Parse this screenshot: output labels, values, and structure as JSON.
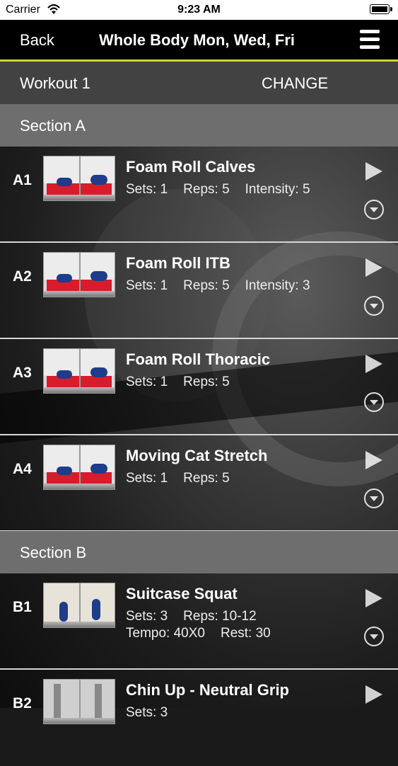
{
  "status_bar": {
    "carrier": "Carrier",
    "time": "9:23 AM"
  },
  "nav": {
    "back_label": "Back",
    "title": "Whole Body Mon, Wed, Fri"
  },
  "workout_bar": {
    "label": "Workout 1",
    "change_label": "CHANGE"
  },
  "sections": [
    {
      "label": "Section A"
    },
    {
      "label": "Section B"
    }
  ],
  "exercises": [
    {
      "code": "A1",
      "name": "Foam Roll Calves",
      "sets": "Sets: 1",
      "reps": "Reps: 5",
      "intensity": "Intensity: 5"
    },
    {
      "code": "A2",
      "name": "Foam Roll ITB",
      "sets": "Sets: 1",
      "reps": "Reps: 5",
      "intensity": "Intensity: 3"
    },
    {
      "code": "A3",
      "name": "Foam Roll Thoracic",
      "sets": "Sets: 1",
      "reps": "Reps: 5"
    },
    {
      "code": "A4",
      "name": "Moving Cat Stretch",
      "sets": "Sets: 1",
      "reps": "Reps: 5"
    },
    {
      "code": "B1",
      "name": "Suitcase Squat",
      "sets": "Sets: 3",
      "reps": "Reps: 10-12",
      "tempo": "Tempo: 40X0",
      "rest": "Rest: 30"
    },
    {
      "code": "B2",
      "name": "Chin Up - Neutral Grip",
      "sets": "Sets: 3"
    }
  ],
  "colors": {
    "accent": "#cfd12e",
    "mat": "#d81c2b",
    "nav_bg": "#000000",
    "section_bg": "#6e6e6e"
  },
  "icons": [
    "wifi-icon",
    "battery-icon",
    "menu-icon",
    "play-icon",
    "expand-icon"
  ]
}
